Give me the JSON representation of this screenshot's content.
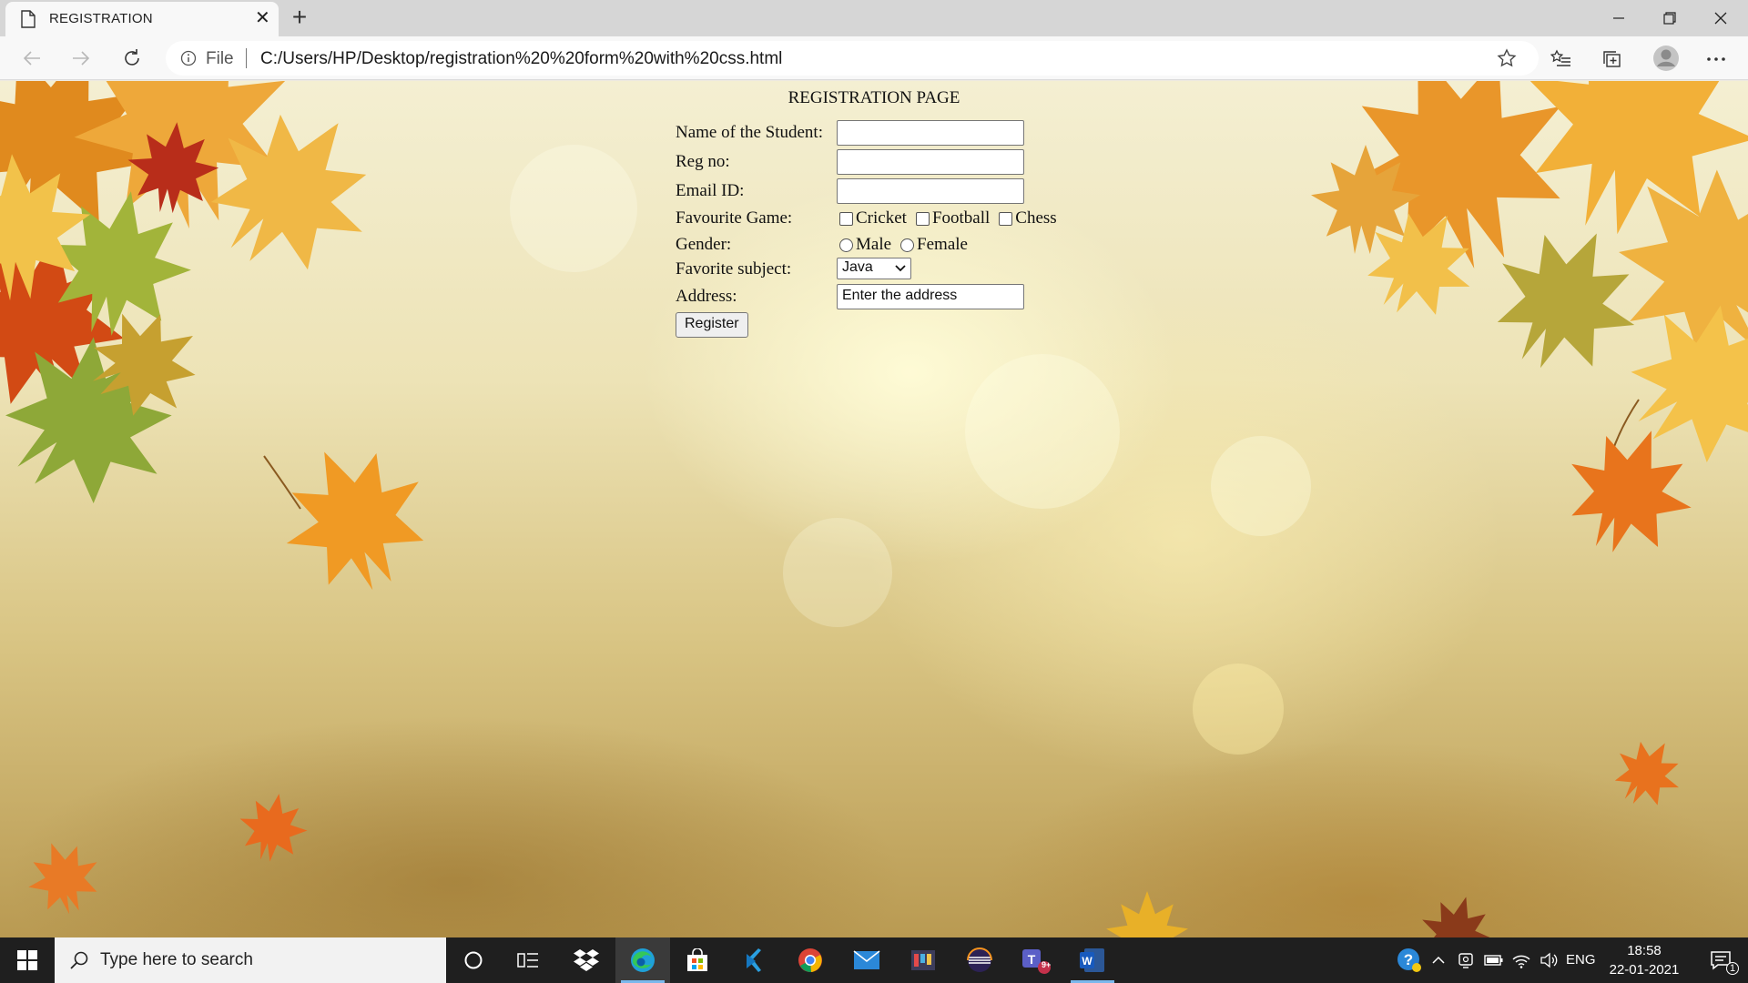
{
  "browser": {
    "tab_title": "REGISTRATION",
    "address_scheme": "File",
    "address_url": "C:/Users/HP/Desktop/registration%20%20form%20with%20css.html"
  },
  "page": {
    "title": "REGISTRATION PAGE",
    "form": {
      "name_label": "Name of the Student:",
      "name_value": "",
      "regno_label": "Reg no:",
      "regno_value": "",
      "email_label": "Email ID:",
      "email_value": "",
      "game_label": "Favourite Game:",
      "games": [
        "Cricket",
        "Football",
        "Chess"
      ],
      "gender_label": "Gender:",
      "genders": [
        "Male",
        "Female"
      ],
      "subject_label": "Favorite subject:",
      "subject_selected": "Java",
      "address_label": "Address:",
      "address_value": "Enter the address",
      "register_label": "Register"
    }
  },
  "taskbar": {
    "search_placeholder": "Type here to search",
    "language": "ENG",
    "time": "18:58",
    "date": "22-01-2021",
    "teams_badge": "9+",
    "notification_count": "1"
  },
  "colors": {
    "taskbar_bg": "#1f1f1f",
    "active_underline": "#7ab8ec"
  }
}
